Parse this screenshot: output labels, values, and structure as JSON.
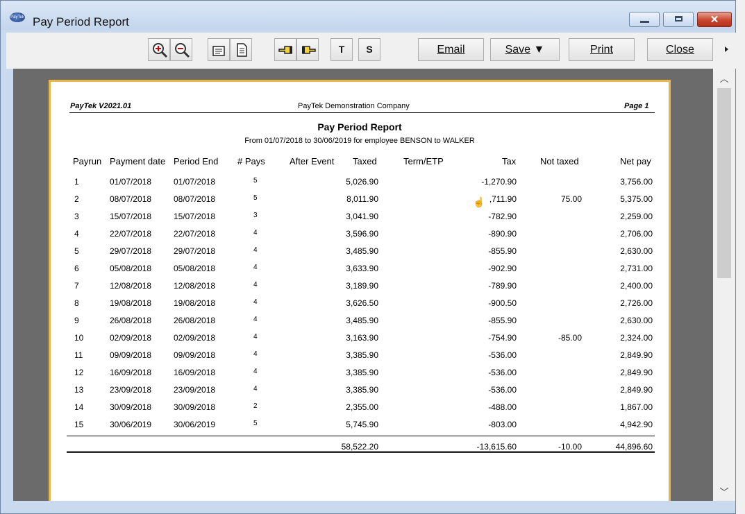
{
  "window": {
    "title": "Pay Period Report",
    "icon": "paytek-logo-icon"
  },
  "toolbar": {
    "email": "Email",
    "save": "Save",
    "print": "Print",
    "close": "Close",
    "text_button": "T",
    "summary_button": "S"
  },
  "report": {
    "version": "PayTek V2021.01",
    "company": "PayTek Demonstration Company",
    "page": "Page 1",
    "title": "Pay Period Report",
    "subtitle": "From 01/07/2018 to 30/06/2019 for employee BENSON to WALKER",
    "columns": [
      "Payrun",
      "Payment date",
      "Period End",
      "# Pays",
      "After Event",
      "Taxed",
      "Term/ETP",
      "Tax",
      "Not taxed",
      "Net pay"
    ],
    "rows": [
      {
        "payrun": "1",
        "payment": "01/07/2018",
        "period": "01/07/2018",
        "pays": "5",
        "taxed": "5,026.90",
        "tax": "-1,270.90",
        "nottaxed": "",
        "net": "3,756.00"
      },
      {
        "payrun": "2",
        "payment": "08/07/2018",
        "period": "08/07/2018",
        "pays": "5",
        "taxed": "8,011.90",
        "tax": ",711.90",
        "nottaxed": "75.00",
        "net": "5,375.00"
      },
      {
        "payrun": "3",
        "payment": "15/07/2018",
        "period": "15/07/2018",
        "pays": "3",
        "taxed": "3,041.90",
        "tax": "-782.90",
        "nottaxed": "",
        "net": "2,259.00"
      },
      {
        "payrun": "4",
        "payment": "22/07/2018",
        "period": "22/07/2018",
        "pays": "4",
        "taxed": "3,596.90",
        "tax": "-890.90",
        "nottaxed": "",
        "net": "2,706.00"
      },
      {
        "payrun": "5",
        "payment": "29/07/2018",
        "period": "29/07/2018",
        "pays": "4",
        "taxed": "3,485.90",
        "tax": "-855.90",
        "nottaxed": "",
        "net": "2,630.00"
      },
      {
        "payrun": "6",
        "payment": "05/08/2018",
        "period": "05/08/2018",
        "pays": "4",
        "taxed": "3,633.90",
        "tax": "-902.90",
        "nottaxed": "",
        "net": "2,731.00"
      },
      {
        "payrun": "7",
        "payment": "12/08/2018",
        "period": "12/08/2018",
        "pays": "4",
        "taxed": "3,189.90",
        "tax": "-789.90",
        "nottaxed": "",
        "net": "2,400.00"
      },
      {
        "payrun": "8",
        "payment": "19/08/2018",
        "period": "19/08/2018",
        "pays": "4",
        "taxed": "3,626.50",
        "tax": "-900.50",
        "nottaxed": "",
        "net": "2,726.00"
      },
      {
        "payrun": "9",
        "payment": "26/08/2018",
        "period": "26/08/2018",
        "pays": "4",
        "taxed": "3,485.90",
        "tax": "-855.90",
        "nottaxed": "",
        "net": "2,630.00"
      },
      {
        "payrun": "10",
        "payment": "02/09/2018",
        "period": "02/09/2018",
        "pays": "4",
        "taxed": "3,163.90",
        "tax": "-754.90",
        "nottaxed": "-85.00",
        "net": "2,324.00"
      },
      {
        "payrun": "11",
        "payment": "09/09/2018",
        "period": "09/09/2018",
        "pays": "4",
        "taxed": "3,385.90",
        "tax": "-536.00",
        "nottaxed": "",
        "net": "2,849.90"
      },
      {
        "payrun": "12",
        "payment": "16/09/2018",
        "period": "16/09/2018",
        "pays": "4",
        "taxed": "3,385.90",
        "tax": "-536.00",
        "nottaxed": "",
        "net": "2,849.90"
      },
      {
        "payrun": "13",
        "payment": "23/09/2018",
        "period": "23/09/2018",
        "pays": "4",
        "taxed": "3,385.90",
        "tax": "-536.00",
        "nottaxed": "",
        "net": "2,849.90"
      },
      {
        "payrun": "14",
        "payment": "30/09/2018",
        "period": "30/09/2018",
        "pays": "2",
        "taxed": "2,355.00",
        "tax": "-488.00",
        "nottaxed": "",
        "net": "1,867.00"
      },
      {
        "payrun": "15",
        "payment": "30/06/2019",
        "period": "30/06/2019",
        "pays": "5",
        "taxed": "5,745.90",
        "tax": "-803.00",
        "nottaxed": "",
        "net": "4,942.90"
      }
    ],
    "totals": {
      "taxed": "58,522.20",
      "tax": "-13,615.60",
      "nottaxed": "-10.00",
      "net": "44,896.60"
    }
  }
}
